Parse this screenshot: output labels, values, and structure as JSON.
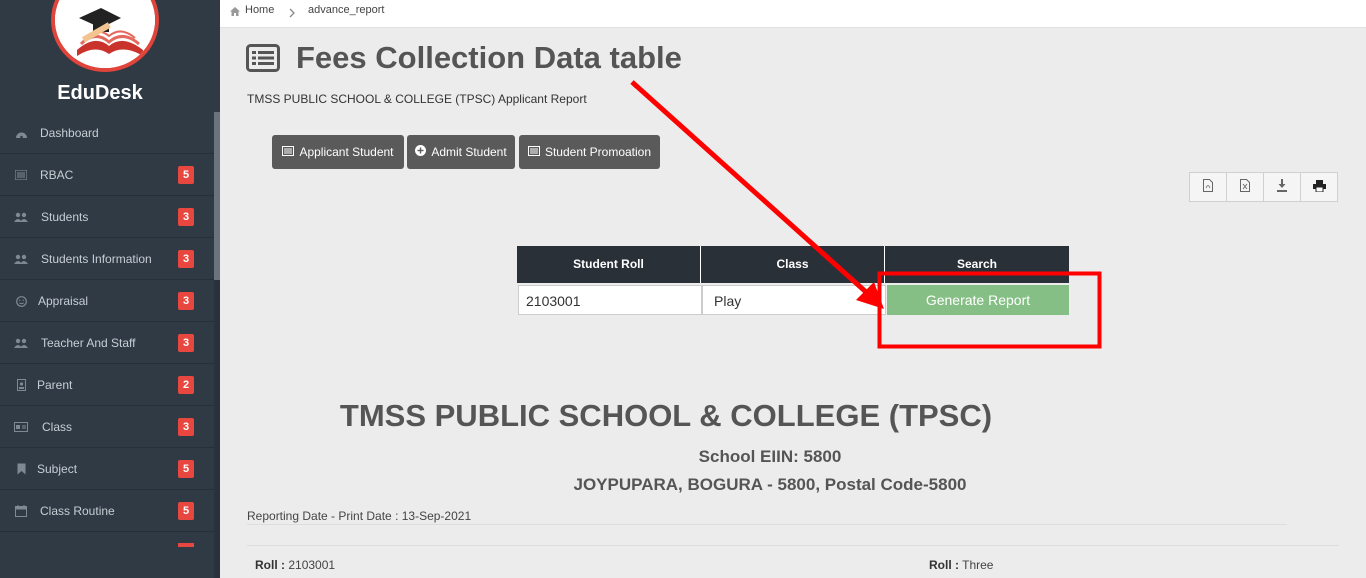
{
  "brand": {
    "name": "EduDesk"
  },
  "breadcrumb": {
    "home": "Home",
    "current": "advance_report"
  },
  "sidebar": {
    "items": [
      {
        "label": "Dashboard",
        "icon": "dashboard-icon",
        "badge": ""
      },
      {
        "label": "RBAC",
        "icon": "list-icon",
        "badge": "5"
      },
      {
        "label": "Students",
        "icon": "users-icon",
        "badge": "3"
      },
      {
        "label": "Students Information",
        "icon": "users-icon",
        "badge": "3"
      },
      {
        "label": "Appraisal",
        "icon": "smile-icon",
        "badge": "3"
      },
      {
        "label": "Teacher And Staff",
        "icon": "users-icon",
        "badge": "3"
      },
      {
        "label": "Parent",
        "icon": "portrait-icon",
        "badge": "2"
      },
      {
        "label": "Class",
        "icon": "id-card-icon",
        "badge": "3"
      },
      {
        "label": "Subject",
        "icon": "bookmark-icon",
        "badge": "5"
      },
      {
        "label": "Class Routine",
        "icon": "calendar-icon",
        "badge": "5"
      }
    ]
  },
  "header": {
    "title": "Fees Collection Data table",
    "subtitle": "TMSS PUBLIC SCHOOL & COLLEGE (TPSC) Applicant Report"
  },
  "actions": {
    "applicant": "Applicant Student",
    "admit": "Admit Student",
    "promotion": "Student Promoation"
  },
  "search": {
    "col_roll": "Student Roll",
    "col_class": "Class",
    "col_search": "Search",
    "roll_value": "2103001",
    "class_value": "Play",
    "generate": "Generate Report"
  },
  "report": {
    "school": "TMSS PUBLIC SCHOOL & COLLEGE (TPSC)",
    "eiin": "School EIIN: 5800",
    "address": "JOYPUPARA, BOGURA - 5800, Postal Code-5800",
    "date_line": "Reporting Date - Print Date : 13-Sep-2021",
    "roll_label": "Roll :",
    "roll_left": "2103001",
    "roll_right": "Three"
  },
  "colors": {
    "sidebar": "#2f3a45",
    "badge": "#e8473f",
    "generate": "#85bf85",
    "annotation": "#ff0000"
  }
}
